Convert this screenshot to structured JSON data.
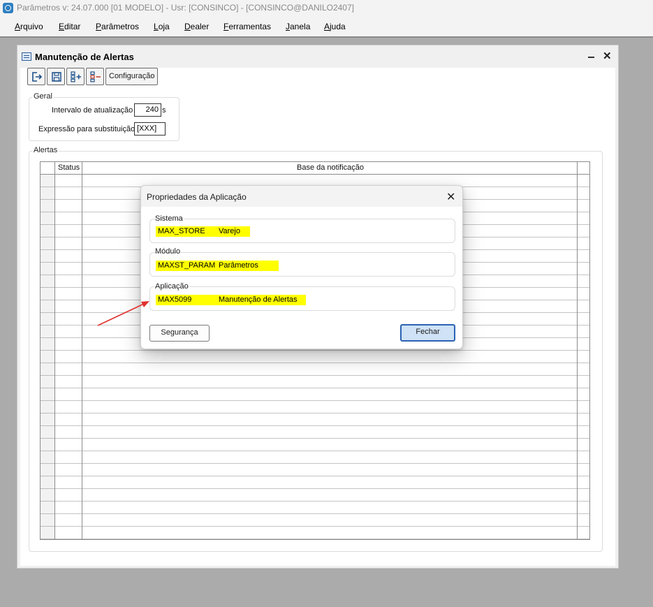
{
  "app": {
    "title": "Parâmetros   v: 24.07.000   [01 MODELO] - Usr: [CONSINCO] - [CONSINCO@DANILO2407]"
  },
  "menu": {
    "items": [
      "Arquivo",
      "Editar",
      "Parâmetros",
      "Loja",
      "Dealer",
      "Ferramentas",
      "Janela",
      "Ajuda"
    ]
  },
  "child_window": {
    "title": "Manutenção de Alertas",
    "toolbar": {
      "config_label": "Configuração",
      "icons": [
        "exit-icon",
        "save-icon",
        "add-row-icon",
        "remove-row-icon"
      ]
    },
    "geral": {
      "legend": "Geral",
      "intervalo_label": "Intervalo de atualização",
      "intervalo_value": "240",
      "intervalo_unit": "s",
      "expressao_label": "Expressão para substituição",
      "expressao_value": "[XXX]"
    },
    "alertas": {
      "legend": "Alertas",
      "columns": [
        "Status",
        "Base da notificação"
      ]
    }
  },
  "dialog": {
    "title": "Propriedades da Aplicação",
    "sistema": {
      "legend": "Sistema",
      "code": "MAX_STORE",
      "name": "Varejo"
    },
    "modulo": {
      "legend": "Módulo",
      "code": "MAXST_PARAM",
      "name": "Parâmetros"
    },
    "aplicacao": {
      "legend": "Aplicação",
      "code": "MAX5099",
      "name": "Manutenção de Alertas"
    },
    "seguranca_label": "Segurança",
    "fechar_label": "Fechar"
  },
  "colors": {
    "highlight": "#ffff00",
    "annotation_arrow": "#e0302c",
    "primary_button_border": "#2a63b3"
  }
}
